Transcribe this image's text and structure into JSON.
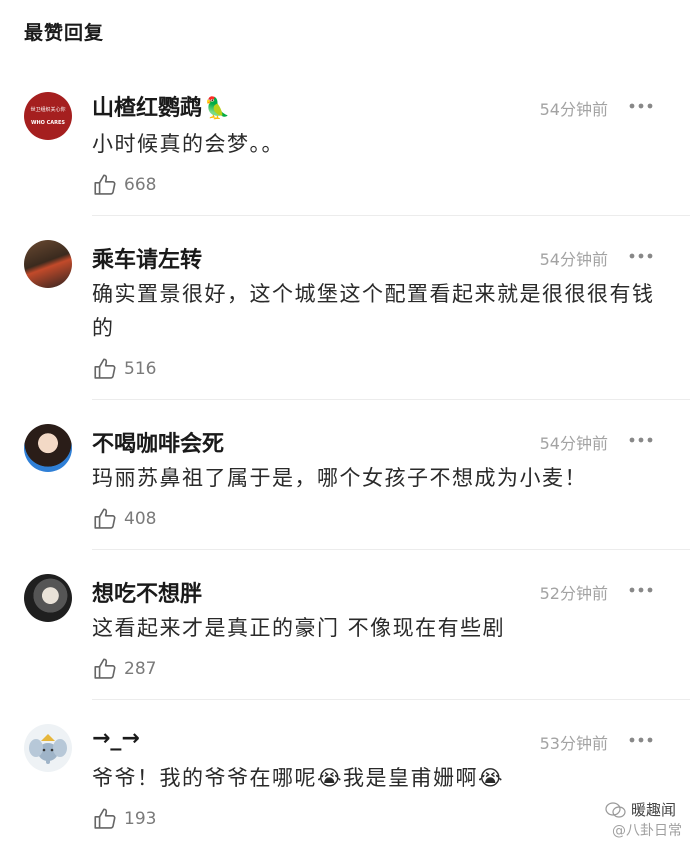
{
  "section_title": "最赞回复",
  "comments": [
    {
      "username": "山楂红鹦鹉",
      "emoji": "🦜",
      "time": "54分钟前",
      "text": "小时候真的会梦。。",
      "likes": "668",
      "avatar_text_top": "世卫组织关心你",
      "avatar_text_bottom": "WHO CARES"
    },
    {
      "username": "乘车请左转",
      "time": "54分钟前",
      "text": "确实置景很好，这个城堡这个配置看起来就是很很很有钱的",
      "likes": "516"
    },
    {
      "username": "不喝咖啡会死",
      "time": "54分钟前",
      "text": "玛丽苏鼻祖了属于是，哪个女孩子不想成为小麦！",
      "likes": "408"
    },
    {
      "username": "想吃不想胖",
      "time": "52分钟前",
      "text": "这看起来才是真正的豪门 不像现在有些剧",
      "likes": "287"
    },
    {
      "username": "→_→",
      "time": "53分钟前",
      "text": "爷爷！我的爷爷在哪呢😭我是皇甫姗啊😭",
      "likes": "193"
    }
  ],
  "watermark": {
    "brand": "暖趣闻",
    "sub": "@八卦日常"
  },
  "colors": {
    "time": "#a3a3a3",
    "divider": "#ececec",
    "like_count": "#7a7a7a"
  }
}
